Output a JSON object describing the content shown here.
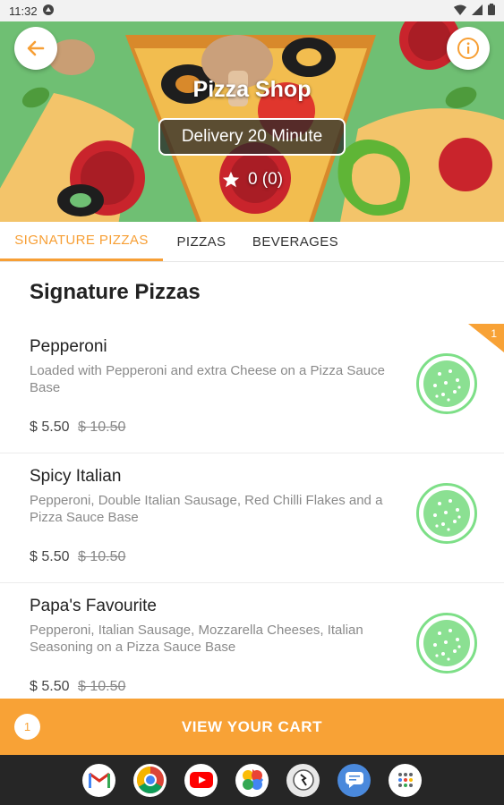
{
  "status_bar": {
    "time": "11:32",
    "icons": [
      "android-debug-icon",
      "wifi-icon",
      "signal-icon",
      "battery-icon"
    ]
  },
  "hero": {
    "title": "Pizza Shop",
    "delivery": "Delivery 20 Minute",
    "rating": "0 (0)",
    "background_color": "#6fbf73"
  },
  "tabs": [
    {
      "label": "SIGNATURE PIZZAS",
      "active": true
    },
    {
      "label": "PIZZAS",
      "active": false
    },
    {
      "label": "BEVERAGES",
      "active": false
    }
  ],
  "section": {
    "title": "Signature Pizzas"
  },
  "items": [
    {
      "name": "Pepperoni",
      "description": "Loaded with Pepperoni and extra Cheese on a Pizza Sauce Base",
      "price": "$ 5.50",
      "old_price": "$ 10.50",
      "in_cart_qty": "1"
    },
    {
      "name": "Spicy Italian",
      "description": "Pepperoni, Double Italian Sausage, Red Chilli Flakes and a Pizza Sauce Base",
      "price": "$ 5.50",
      "old_price": "$ 10.50"
    },
    {
      "name": "Papa's Favourite",
      "description": "Pepperoni, Italian Sausage, Mozzarella Cheeses, Italian Seasoning on a Pizza Sauce Base",
      "price": "$ 5.50",
      "old_price": "$ 10.50"
    }
  ],
  "cart": {
    "count": "1",
    "label": "VIEW YOUR CART"
  },
  "colors": {
    "accent": "#f79f35",
    "cart_bar": "#f8a236",
    "thumb_green": "#7ddf87"
  },
  "dock_apps": [
    "gmail-icon",
    "chrome-icon",
    "youtube-icon",
    "photos-icon",
    "app-icon",
    "messages-icon",
    "app-drawer-icon"
  ]
}
